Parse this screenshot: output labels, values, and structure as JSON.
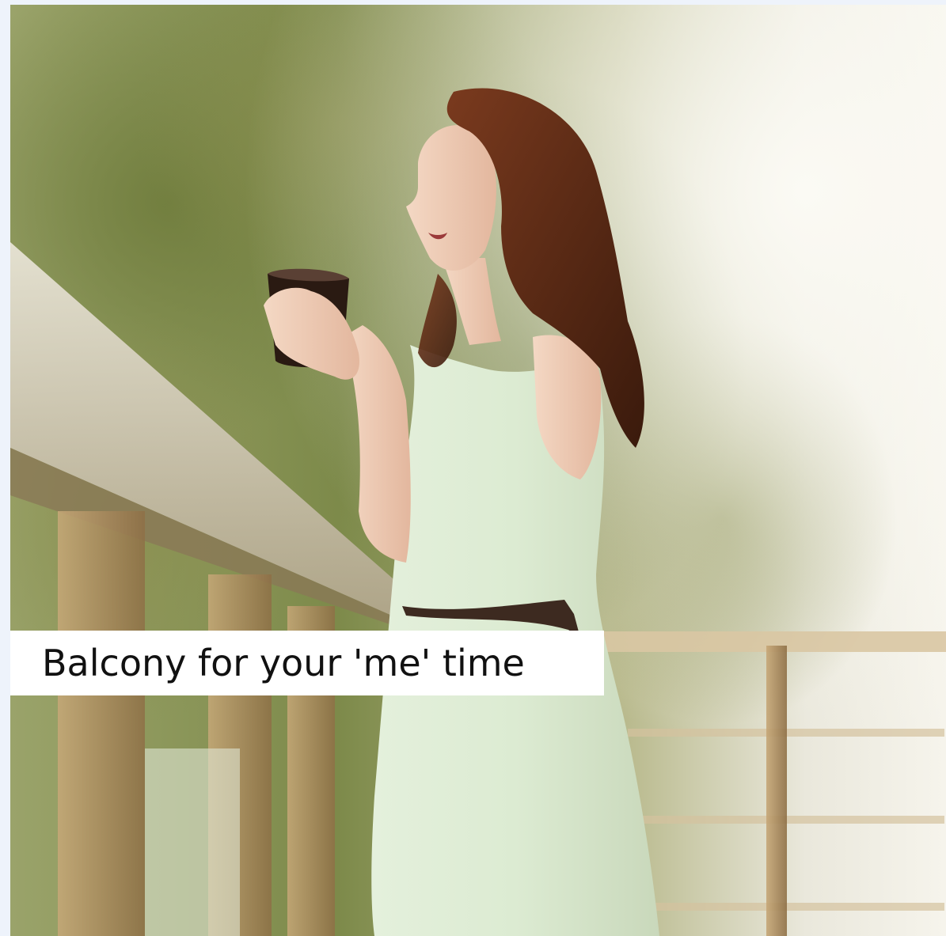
{
  "card": {
    "caption": "Balcony for your 'me' time"
  },
  "photo": {
    "subject": "woman-holding-coffee-cup-on-balcony"
  },
  "colors": {
    "caption_background": "#ffffff",
    "caption_text": "#111111",
    "page_background": "#eef3fb"
  }
}
